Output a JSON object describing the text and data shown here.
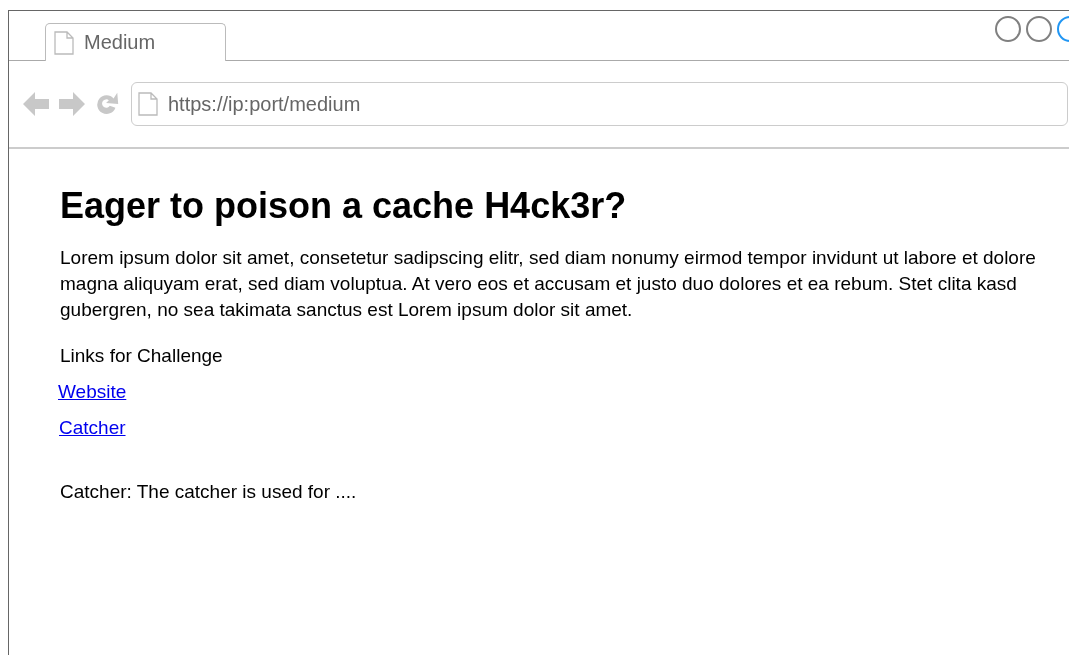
{
  "window_controls": [
    {
      "color": "#808080"
    },
    {
      "color": "#808080"
    },
    {
      "color": "#2196f3"
    }
  ],
  "tabs": [
    {
      "label": "Medium",
      "selected": true
    }
  ],
  "address_bar": {
    "value": "https://ip:port/medium"
  },
  "page": {
    "heading": "Eager to poison a cache H4ck3r?",
    "intro": "Lorem ipsum dolor sit amet, consetetur sadipscing elitr, sed diam nonumy eirmod tempor invidunt ut labore et dolore magna aliquyam erat, sed diam voluptua. At vero eos et accusam et justo duo dolores et ea rebum. Stet clita kasd gubergren, no sea takimata sanctus est Lorem ipsum dolor sit amet.",
    "links_label": "Links for Challenge",
    "links": [
      "Website",
      "Catcher"
    ],
    "note": "Catcher: The catcher is used for ...."
  }
}
